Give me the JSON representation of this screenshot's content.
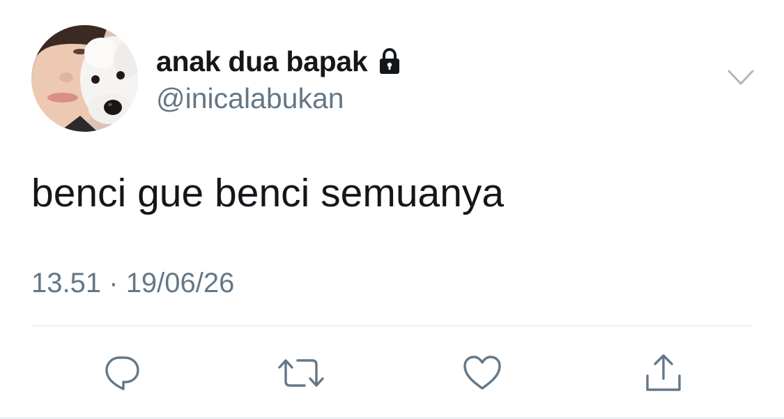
{
  "tweet": {
    "display_name": "anak dua bapak",
    "handle": "@inicalabukan",
    "text": "benci gue benci semuanya",
    "time": "13.51",
    "separator": "·",
    "date": "19/06/26",
    "protected": true
  },
  "icons": {
    "lock": "lock-icon",
    "caret": "chevron-down-icon",
    "reply": "reply-icon",
    "retweet": "retweet-icon",
    "like": "heart-icon",
    "share": "share-icon"
  },
  "colors": {
    "text": "#14171a",
    "secondary": "#657786",
    "divider": "#e1e8ed",
    "caret": "#aab8c2"
  }
}
